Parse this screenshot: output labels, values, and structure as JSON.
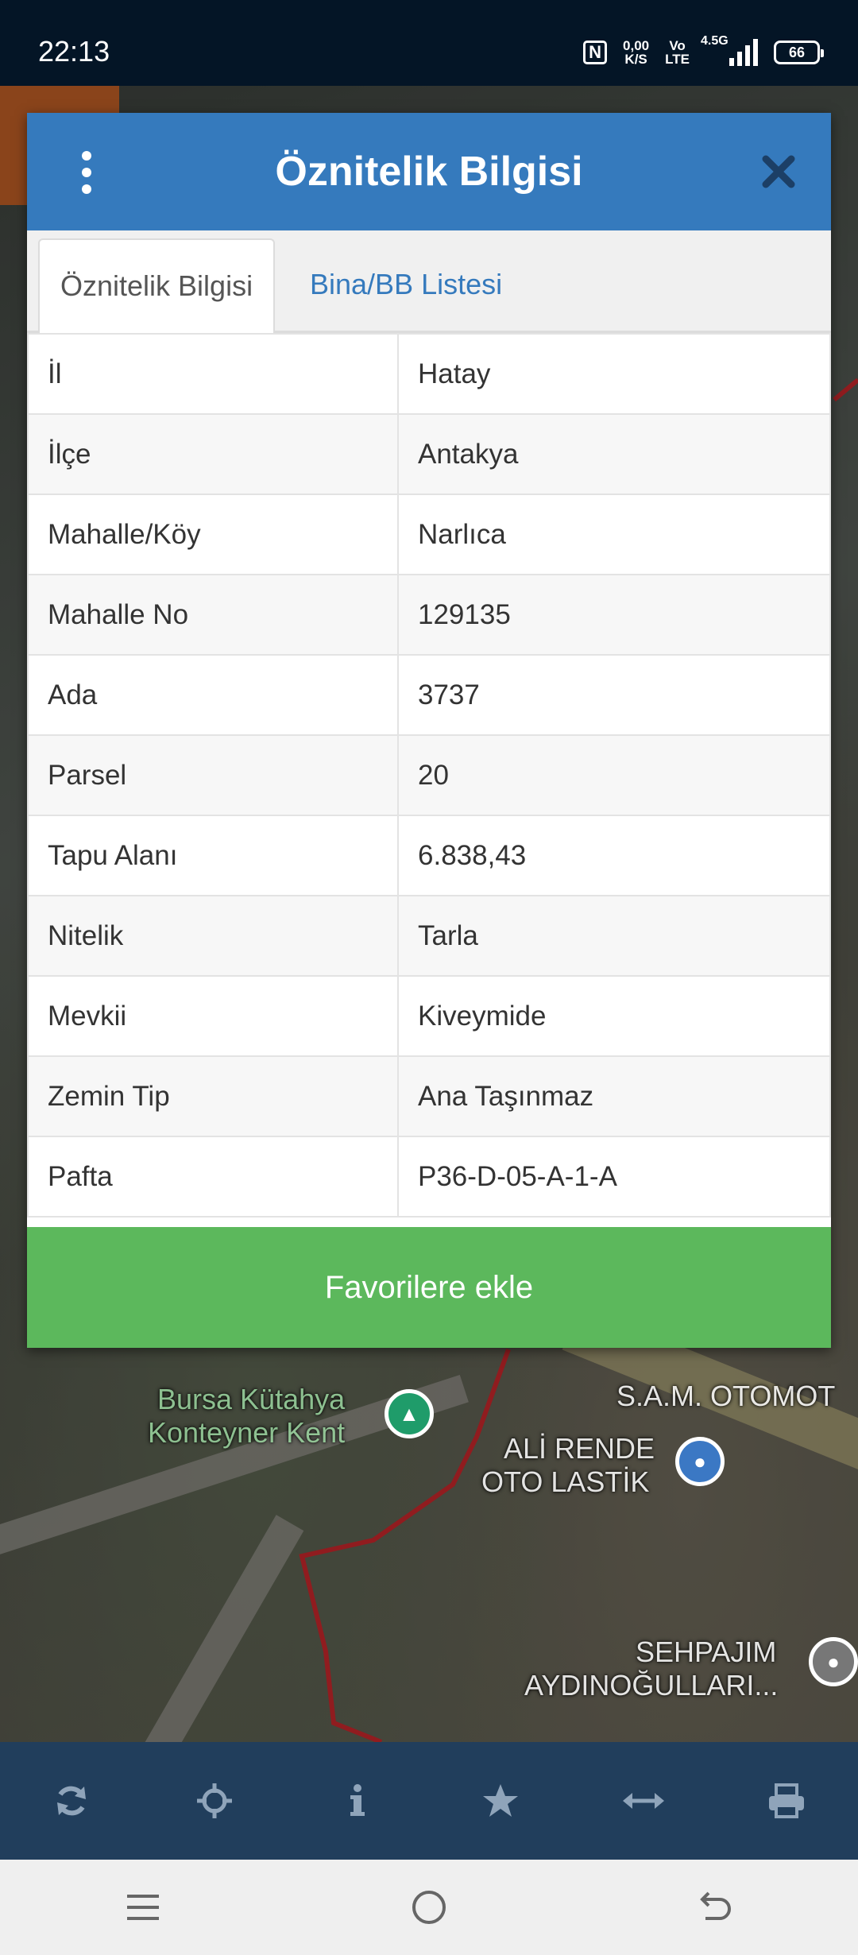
{
  "status_bar": {
    "time": "22:13",
    "net_speed_value": "0,00",
    "net_speed_unit": "K/S",
    "volte_top": "Vo",
    "volte_bottom": "LTE",
    "network": "4.5G",
    "battery": "66"
  },
  "map": {
    "labels": [
      {
        "text": "Bursa Kütahya"
      },
      {
        "text": "Konteyner Kent"
      },
      {
        "text": "ALİ RENDE"
      },
      {
        "text": "OTO LASTİK"
      },
      {
        "text": "S.A.M. OTOMOT"
      },
      {
        "text": "SEHPAJIM"
      },
      {
        "text": "AYDINOĞULLARI..."
      }
    ]
  },
  "dialog": {
    "title": "Öznitelik Bilgisi",
    "tabs": [
      {
        "label": "Öznitelik Bilgisi",
        "active": true
      },
      {
        "label": "Bina/BB Listesi",
        "active": false
      }
    ],
    "rows": [
      {
        "key": "İl",
        "value": "Hatay"
      },
      {
        "key": "İlçe",
        "value": "Antakya"
      },
      {
        "key": "Mahalle/Köy",
        "value": "Narlıca"
      },
      {
        "key": "Mahalle No",
        "value": "129135"
      },
      {
        "key": "Ada",
        "value": "3737"
      },
      {
        "key": "Parsel",
        "value": "20"
      },
      {
        "key": "Tapu Alanı",
        "value": "6.838,43"
      },
      {
        "key": "Nitelik",
        "value": "Tarla"
      },
      {
        "key": "Mevkii",
        "value": "Kiveymide"
      },
      {
        "key": "Zemin Tip",
        "value": "Ana Taşınmaz"
      },
      {
        "key": "Pafta",
        "value": "P36-D-05-A-1-A"
      }
    ],
    "favorite_button": "Favorilere ekle"
  },
  "toolbar": {
    "icons": [
      "refresh-icon",
      "locate-icon",
      "info-icon",
      "star-icon",
      "measure-icon",
      "print-icon"
    ]
  },
  "colors": {
    "header_blue": "#357abd",
    "button_green": "#5cb85c",
    "toolbar_bg": "#213e5c",
    "status_bg": "#041526"
  }
}
